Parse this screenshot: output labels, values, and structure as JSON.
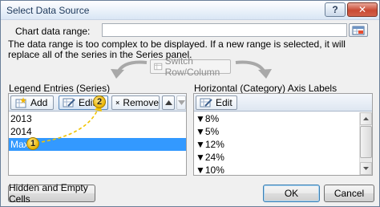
{
  "window": {
    "title": "Select Data Source",
    "help": "?",
    "close": "✕"
  },
  "chart_range": {
    "label": "Chart data range:",
    "value": ""
  },
  "message": "The data range is too complex to be displayed. If a new range is selected, it will replace all of the series in the Series panel.",
  "switch_button": "Switch Row/Column",
  "legend_panel": {
    "label": "Legend Entries (Series)",
    "add": "Add",
    "edit": "Edit",
    "remove": "Remove",
    "items": [
      "2013",
      "2014",
      "Max"
    ],
    "selected_index": 2
  },
  "axis_panel": {
    "label": "Horizontal (Category) Axis Labels",
    "edit": "Edit",
    "items": [
      "▼8%",
      "▼5%",
      "▼12%",
      "▼24%",
      "▼10%"
    ]
  },
  "hidden_cells_button": "Hidden and Empty Cells",
  "ok": "OK",
  "cancel": "Cancel",
  "callouts": [
    "1",
    "2"
  ],
  "colors": {
    "selection": "#3399ff",
    "callout": "#f2c300",
    "titlebar": "#d9e6f5"
  }
}
